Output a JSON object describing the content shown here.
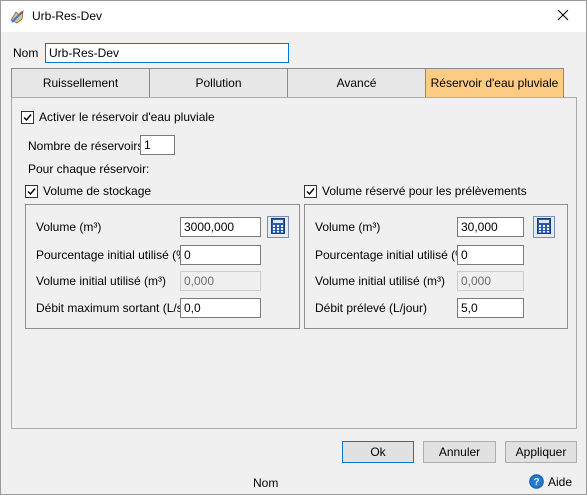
{
  "window": {
    "title": "Urb-Res-Dev"
  },
  "name_field": {
    "label": "Nom",
    "value": "Urb-Res-Dev"
  },
  "tabs": [
    {
      "label": "Ruissellement",
      "active": false
    },
    {
      "label": "Pollution",
      "active": false
    },
    {
      "label": "Avancé",
      "active": false
    },
    {
      "label": "Réservoir d'eau pluviale",
      "active": true
    }
  ],
  "panel": {
    "activate_label": "Activer le réservoir d'eau pluviale",
    "activate_checked": true,
    "count_label": "Nombre de réservoirs",
    "count_value": "1",
    "per_tank_label": "Pour chaque réservoir:"
  },
  "storage": {
    "checkbox_label": "Volume de stockage",
    "checked": true,
    "volume_label": "Volume (m³)",
    "volume_value": "3000,000",
    "pct_label": "Pourcentage initial utilisé (%)",
    "pct_value": "0",
    "initial_label": "Volume initial utilisé (m³)",
    "initial_value": "0,000",
    "outflow_label": "Débit maximum sortant (L/s)",
    "outflow_value": "0,0"
  },
  "withdrawal": {
    "checkbox_label": "Volume réservé pour les prélèvements",
    "checked": true,
    "volume_label": "Volume (m³)",
    "volume_value": "30,000",
    "pct_label": "Pourcentage initial utilisé (%)",
    "pct_value": "0",
    "initial_label": "Volume initial utilisé (m³)",
    "initial_value": "0,000",
    "rate_label": "Débit prélevé (L/jour)",
    "rate_value": "5,0"
  },
  "buttons": {
    "ok": "Ok",
    "cancel": "Annuler",
    "apply": "Appliquer"
  },
  "status": {
    "text": "Nom",
    "help_label": "Aide"
  },
  "colors": {
    "active_tab": "#fccc84",
    "focus_border": "#0078d7",
    "help_icon": "#1e7ad2"
  },
  "icons": {
    "app": "map-pen-icon",
    "close": "close-icon",
    "calculator": "calculator-icon",
    "help": "help-icon"
  }
}
